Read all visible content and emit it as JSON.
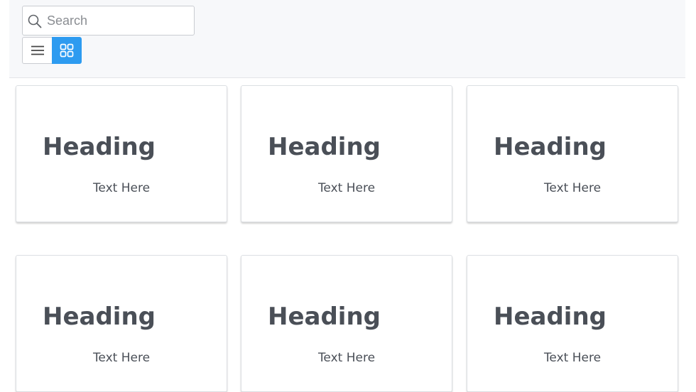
{
  "search": {
    "placeholder": "Search",
    "value": ""
  },
  "view_toggle": {
    "options": [
      "list",
      "grid"
    ],
    "selected": "grid",
    "active_color": "#2d9bf0"
  },
  "cards": [
    {
      "heading": "Heading",
      "text": "Text Here"
    },
    {
      "heading": "Heading",
      "text": "Text Here"
    },
    {
      "heading": "Heading",
      "text": "Text Here"
    },
    {
      "heading": "Heading",
      "text": "Text Here"
    },
    {
      "heading": "Heading",
      "text": "Text Here"
    },
    {
      "heading": "Heading",
      "text": "Text Here"
    }
  ]
}
